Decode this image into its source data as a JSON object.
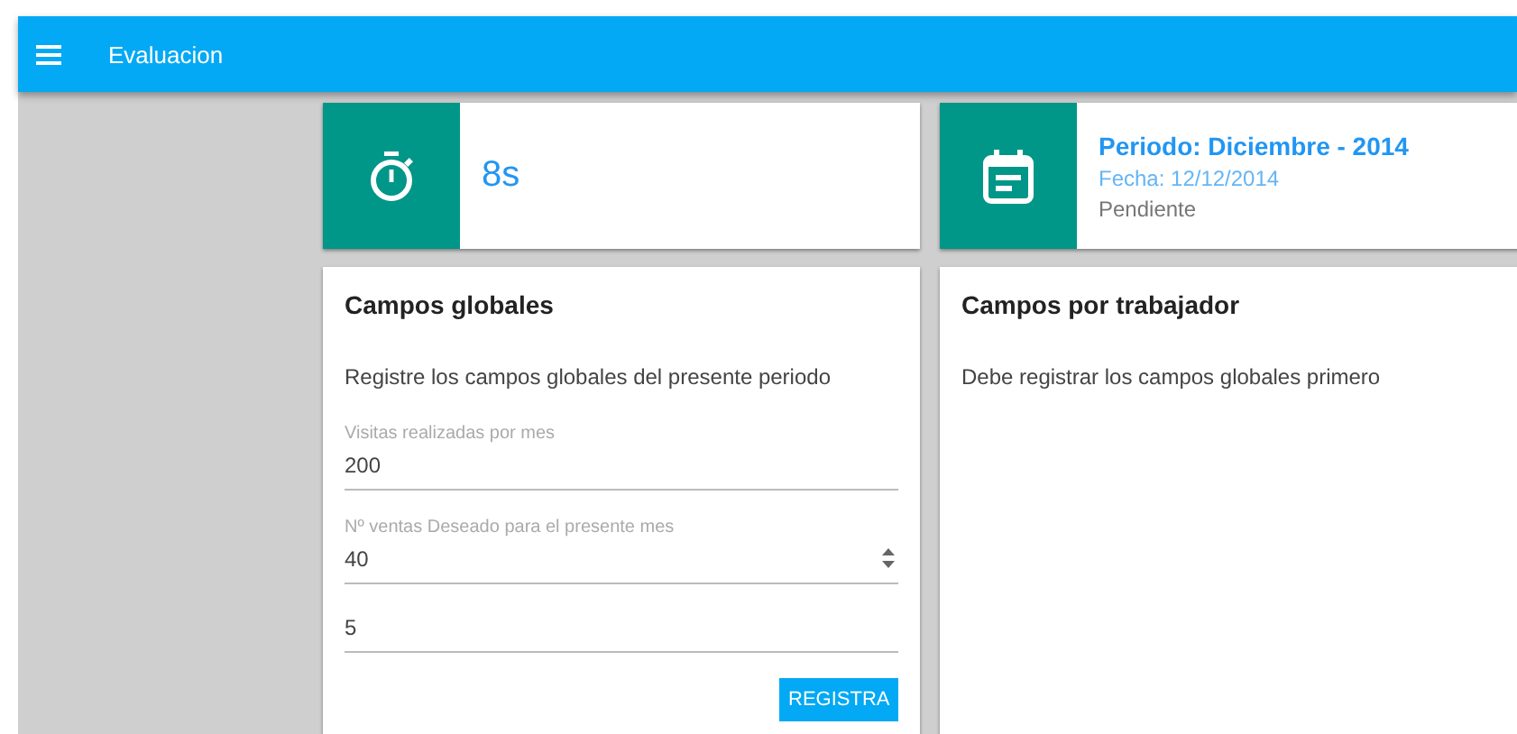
{
  "app_bar": {
    "title": "Evaluacion"
  },
  "timer_card": {
    "value": "8s"
  },
  "period_card": {
    "period": "Periodo: Diciembre - 2014",
    "date": "Fecha: 12/12/2014",
    "status": "Pendiente"
  },
  "global_fields": {
    "title": "Campos globales",
    "description": "Registre los campos globales del presente periodo",
    "fields": [
      {
        "label": "Visitas realizadas por mes",
        "value": "200",
        "spinner": false
      },
      {
        "label": "Nº ventas Deseado para el presente mes",
        "value": "40",
        "spinner": true
      },
      {
        "value": "5",
        "spinner": false
      }
    ],
    "button": "REGISTRA"
  },
  "worker_fields": {
    "title": "Campos por trabajador",
    "description": "Debe registrar los campos globales primero"
  }
}
